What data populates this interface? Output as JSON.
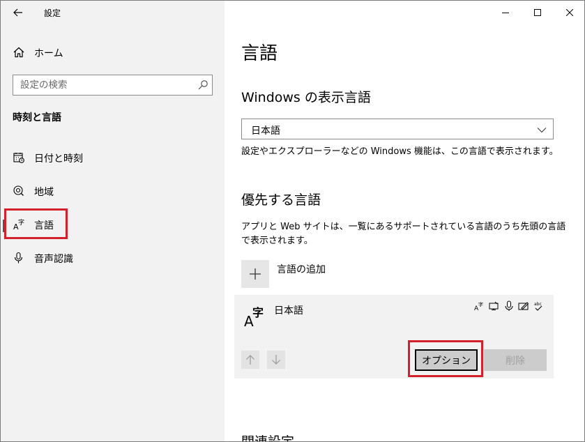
{
  "window": {
    "app_title": "設定",
    "controls": {
      "minimize": "—",
      "maximize": "☐",
      "close": "✕"
    }
  },
  "sidebar": {
    "home_label": "ホーム",
    "search_placeholder": "設定の検索",
    "section_title": "時刻と言語",
    "items": [
      {
        "label": "日付と時刻",
        "icon": "clock-calendar-icon"
      },
      {
        "label": "地域",
        "icon": "globe-icon"
      },
      {
        "label": "言語",
        "icon": "language-icon",
        "active": true
      },
      {
        "label": "音声認識",
        "icon": "microphone-icon"
      }
    ]
  },
  "main": {
    "page_title": "言語",
    "display_language": {
      "heading": "Windows の表示言語",
      "selected": "日本語",
      "description": "設定やエクスプローラーなどの Windows 機能は、この言語で表示されます。"
    },
    "preferred": {
      "heading": "優先する言語",
      "description_line1": "アプリと Web サイトは、一覧にあるサポートされている言語のうち先頭の言語",
      "description_line2": "で表示されます。",
      "add_label": "言語の追加",
      "language": {
        "name": "日本語",
        "icon_text": "A字",
        "feature_icons": [
          "language-pack-icon",
          "text-to-speech-icon",
          "speech-recognition-icon",
          "handwriting-icon",
          "spell-check-icon"
        ],
        "options_label": "オプション",
        "remove_label": "削除"
      }
    },
    "related_heading": "関連設定"
  },
  "colors": {
    "highlight": "#d4202b",
    "sidebar_bg": "#f2f2f2",
    "card_bg": "#f2f2f2"
  }
}
